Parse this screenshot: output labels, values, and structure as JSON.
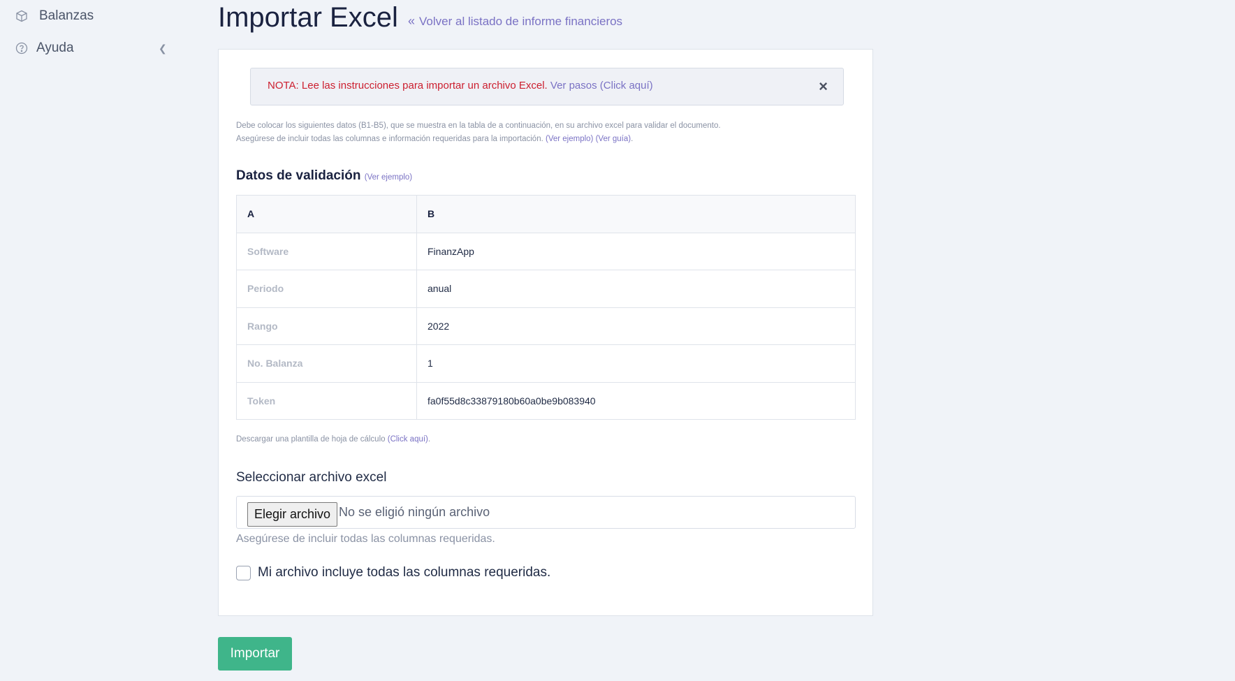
{
  "sidebar": {
    "items": [
      {
        "label": "Balanzas",
        "icon": "cube-icon"
      },
      {
        "label": "Ayuda",
        "icon": "help-circle-icon"
      }
    ]
  },
  "header": {
    "title": "Importar Excel",
    "separator": ".",
    "back_link": "Volver al listado de informe financieros"
  },
  "alert": {
    "note": "NOTA: Lee las instrucciones para importar un archivo Excel.",
    "link": "Ver pasos (Click aquí)",
    "close": "×"
  },
  "help": {
    "line1": "Debe colocar los siguientes datos (B1-B5), que se muestra en la tabla de a continuación, en su archivo excel para validar el documento.",
    "line2": "Asegúrese de incluir todas las columnas e información requeridas para la importación.",
    "example_link": "(Ver ejemplo)",
    "guide_link": "(Ver guía)",
    "line2_end": "."
  },
  "validation": {
    "title": "Datos de validación",
    "example_link": "(Ver ejemplo)",
    "headers": [
      "A",
      "B"
    ],
    "rows": [
      {
        "key": "Software",
        "value": "FinanzApp"
      },
      {
        "key": "Periodo",
        "value": "anual"
      },
      {
        "key": "Rango",
        "value": "2022"
      },
      {
        "key": "No. Balanza",
        "value": "1"
      },
      {
        "key": "Token",
        "value": "fa0f55d8c33879180b60a0be9b083940"
      }
    ]
  },
  "template": {
    "text": "Descargar una plantilla de hoja de cálculo",
    "link": "(Click aquí)",
    "end": "."
  },
  "file": {
    "label": "Seleccionar archivo excel",
    "button": "Elegir archivo",
    "status": "No se eligió ningún archivo",
    "hint": "Asegúrese de incluir todas las columnas requeridas."
  },
  "checkbox": {
    "label": "Mi archivo incluye todas las columnas requeridas.",
    "checked": false
  },
  "actions": {
    "import": "Importar"
  },
  "colors": {
    "accent": "#7a72c4",
    "danger": "#cc1f2f",
    "success": "#3fb58a"
  }
}
